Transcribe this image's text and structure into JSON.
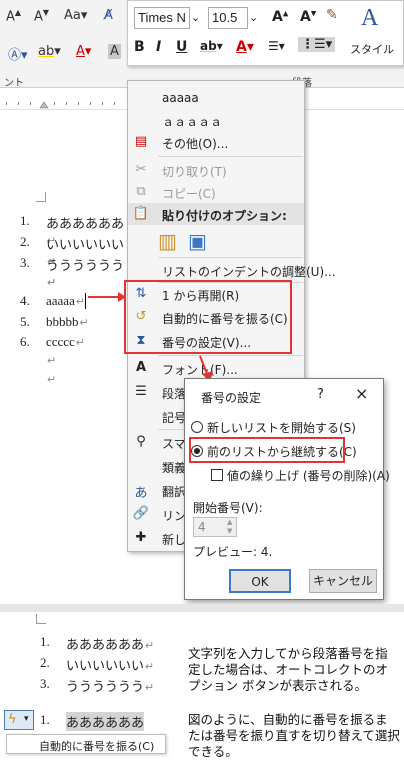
{
  "ribbon": {
    "font_name": "Times N",
    "font_size": "10.5",
    "font_group_label": "ント",
    "para_group_label": "段落",
    "style_label": "スタイル",
    "aa_label": "Aa"
  },
  "context_menu": {
    "recent1": "aaaaa",
    "recent2": "ａａａａａ",
    "more": "その他(O)...",
    "cut": "切り取り(T)",
    "copy": "コピー(C)",
    "paste_options": "貼り付けのオプション:",
    "adjust_indent": "リストのインデントの調整(U)...",
    "restart_at_1": "1 から再開(R)",
    "auto_numbering": "自動的に番号を振る(C)",
    "set_numbering": "番号の設定(V)...",
    "font": "フォント(F)...",
    "paragraph": "段落",
    "symbol": "記号",
    "smart": "スマー",
    "synonym": "類義",
    "translate": "翻訳",
    "link": "リンク",
    "new": "新し"
  },
  "document": {
    "list": [
      {
        "num": "1.",
        "text": "ああああああ"
      },
      {
        "num": "2.",
        "text": "いいいいいい"
      },
      {
        "num": "3.",
        "text": "うううううう"
      },
      {
        "num": "4.",
        "text": "aaaaa"
      },
      {
        "num": "5.",
        "text": "bbbbb"
      },
      {
        "num": "6.",
        "text": "ccccc"
      }
    ]
  },
  "dialog": {
    "title": "番号の設定",
    "help": "?",
    "close": "×",
    "option_new": "新しいリストを開始する(S)",
    "option_continue": "前のリストから継続する(C)",
    "checkbox_label": "値の繰り上げ (番号の削除)(A)",
    "start_label": "開始番号(V):",
    "start_value": "4",
    "preview": "プレビュー: 4.",
    "ok": "OK",
    "cancel": "キャンセル"
  },
  "bottom": {
    "list": [
      {
        "num": "1.",
        "text": "ああああああ"
      },
      {
        "num": "2.",
        "text": "いいいいいい"
      },
      {
        "num": "3.",
        "text": "うううううう"
      },
      {
        "num": "1.",
        "text": "ああああああ"
      }
    ],
    "autocorrect_option": "自動的に番号を振る(C)",
    "note1": "文字列を入力してから段落番号を指定した場合は、オートコレクトのオプション ボタンが表示される。",
    "note2": "図のように、自動的に番号を振るまたは番号を振り直すを切り替えて選択できる。"
  },
  "colors": {
    "highlight_red": "#e53333",
    "accent_blue": "#2b579a"
  }
}
